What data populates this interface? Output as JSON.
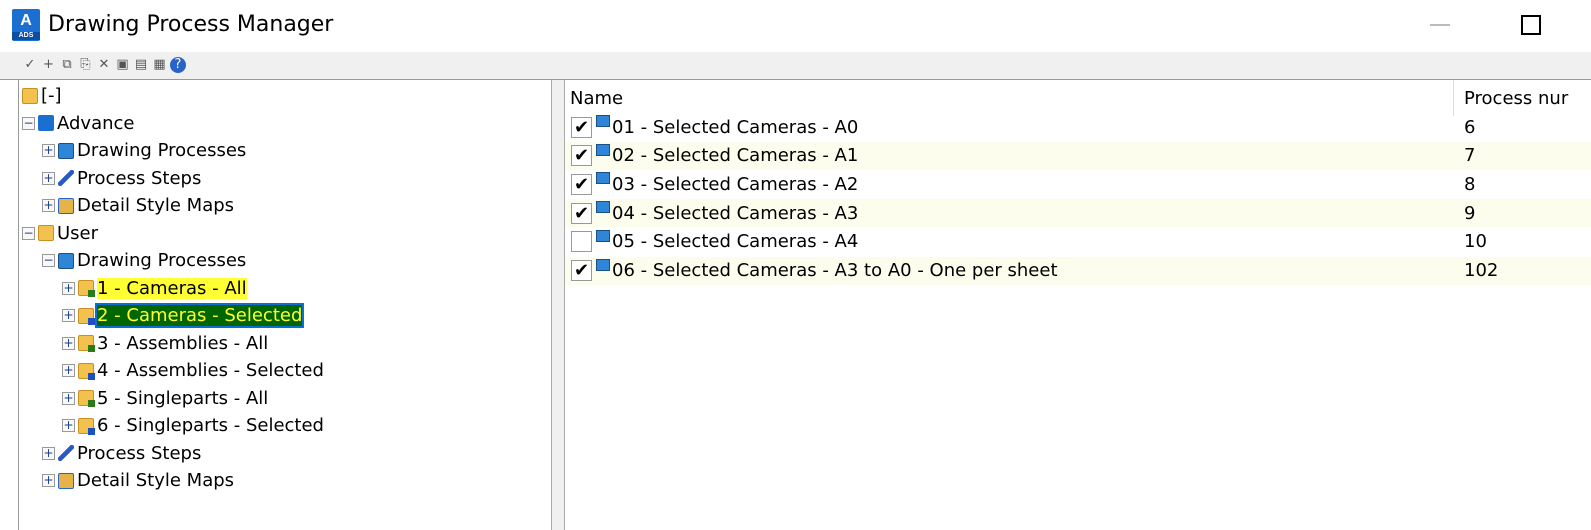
{
  "window": {
    "title": "Drawing Process Manager",
    "logo_text": "A",
    "logo_sub": "ADS"
  },
  "toolbar": [
    {
      "icon": "check-document-icon",
      "glyph": "✓"
    },
    {
      "icon": "new-document-icon",
      "glyph": "+"
    },
    {
      "icon": "copy-icon",
      "glyph": "⧉"
    },
    {
      "icon": "paste-icon",
      "glyph": "⎘"
    },
    {
      "icon": "delete-icon",
      "glyph": "✕"
    },
    {
      "icon": "monitor-icon",
      "glyph": "▣"
    },
    {
      "icon": "export-icon",
      "glyph": "▤"
    },
    {
      "icon": "import-icon",
      "glyph": "▦"
    },
    {
      "icon": "help-icon",
      "glyph": "?"
    }
  ],
  "tree": [
    {
      "label": "[-]",
      "level": 0,
      "icon": "folder",
      "exp": ""
    },
    {
      "label": "Advance",
      "level": 0,
      "icon": "adv",
      "exp": "−"
    },
    {
      "label": "Drawing Processes",
      "level": 1,
      "icon": "dp",
      "exp": "+"
    },
    {
      "label": "Process Steps",
      "level": 1,
      "icon": "flag",
      "exp": "+"
    },
    {
      "label": "Detail Style Maps",
      "level": 1,
      "icon": "map",
      "exp": "+"
    },
    {
      "label": "User",
      "level": 0,
      "icon": "folder",
      "exp": "−"
    },
    {
      "label": "Drawing Processes",
      "level": 1,
      "icon": "dp",
      "exp": "−"
    },
    {
      "label": "1 - Cameras - All",
      "level": 2,
      "icon": "proc",
      "exp": "+",
      "hl": "yellow"
    },
    {
      "label": "2 - Cameras - Selected",
      "level": 2,
      "icon": "proc blue",
      "exp": "+",
      "hl": "sel"
    },
    {
      "label": "3 - Assemblies - All",
      "level": 2,
      "icon": "proc",
      "exp": "+"
    },
    {
      "label": "4 - Assemblies - Selected",
      "level": 2,
      "icon": "proc blue",
      "exp": "+"
    },
    {
      "label": "5 - Singleparts - All",
      "level": 2,
      "icon": "proc",
      "exp": "+"
    },
    {
      "label": "6 - Singleparts - Selected",
      "level": 2,
      "icon": "proc blue",
      "exp": "+"
    },
    {
      "label": "Process Steps",
      "level": 1,
      "icon": "flag",
      "exp": "+"
    },
    {
      "label": "Detail Style Maps",
      "level": 1,
      "icon": "map",
      "exp": "+"
    }
  ],
  "list": {
    "columns": [
      "Name",
      "Process nur"
    ],
    "rows": [
      {
        "name": "01 - Selected Cameras - A0",
        "number": "6",
        "checked": true
      },
      {
        "name": "02 - Selected Cameras - A1",
        "number": "7",
        "checked": true
      },
      {
        "name": "03 - Selected Cameras - A2",
        "number": "8",
        "checked": true
      },
      {
        "name": "04 - Selected Cameras - A3",
        "number": "9",
        "checked": true
      },
      {
        "name": "05 - Selected Cameras - A4",
        "number": "10",
        "checked": false
      },
      {
        "name": "06 - Selected Cameras - A3 to A0 - One per sheet",
        "number": "102",
        "checked": true
      }
    ]
  }
}
